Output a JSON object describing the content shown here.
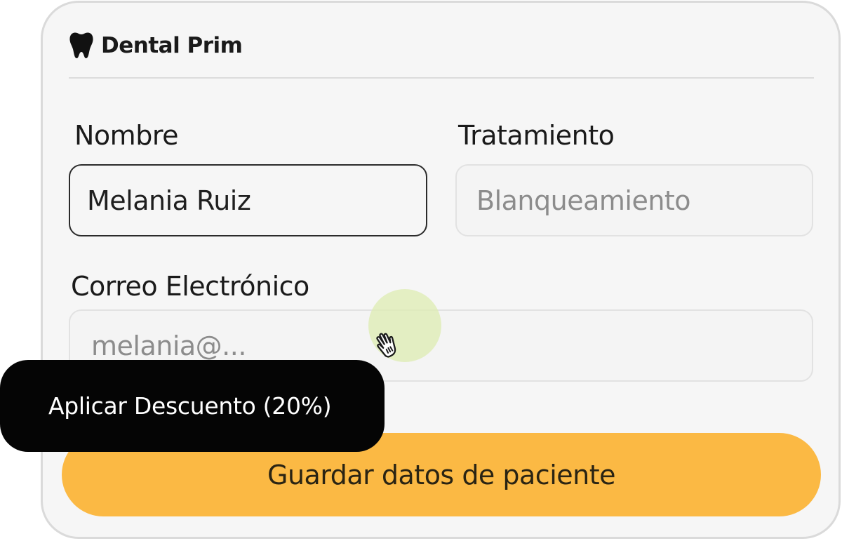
{
  "brand": {
    "name": "Dental Prim",
    "icon": "tooth-icon"
  },
  "form": {
    "name_label": "Nombre",
    "name_value": "Melania Ruiz",
    "treatment_label": "Tratamiento",
    "treatment_placeholder": "Blanqueamiento",
    "email_label": "Correo Electrónico",
    "email_placeholder": "melania@..."
  },
  "tooltip": {
    "text": "Aplicar Descuento (20%)"
  },
  "actions": {
    "save_label": "Guardar datos de paciente"
  },
  "colors": {
    "accent": "#fbb944",
    "tooltip_bg": "#050505",
    "card_bg": "#f6f6f6",
    "click_highlight": "#deecb2"
  },
  "cursor": {
    "icon": "hand-pointer-icon"
  }
}
